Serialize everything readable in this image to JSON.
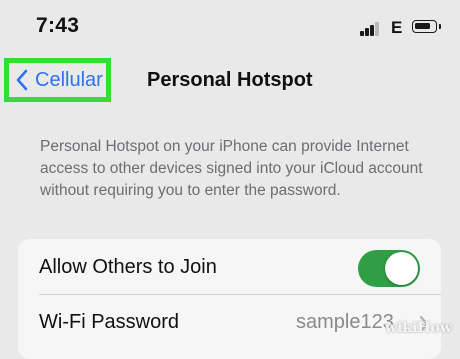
{
  "status_bar": {
    "time": "7:43",
    "network": "E",
    "battery_level": 0.8,
    "signal_bars_active": 3,
    "icons": [
      "signal-icon",
      "battery-icon"
    ]
  },
  "nav": {
    "back_label": "Cellular",
    "back_icon": "chevron-left-icon",
    "title": "Personal Hotspot"
  },
  "description": "Personal Hotspot on your iPhone can provide Internet access to other devices signed into your iCloud account without requiring you to enter the password.",
  "settings": {
    "allow_others": {
      "label": "Allow Others to Join",
      "enabled": true
    },
    "wifi_password": {
      "label": "Wi-Fi Password",
      "value": "sample123",
      "icon": "chevron-right-icon"
    }
  },
  "watermark": "wikiHow",
  "colors": {
    "background": "#e9e9ea",
    "accent_blue": "#2c73ee",
    "toggle_on": "#2f9e45",
    "highlight": "#33dd33",
    "group_background": "#f6f6f7"
  }
}
